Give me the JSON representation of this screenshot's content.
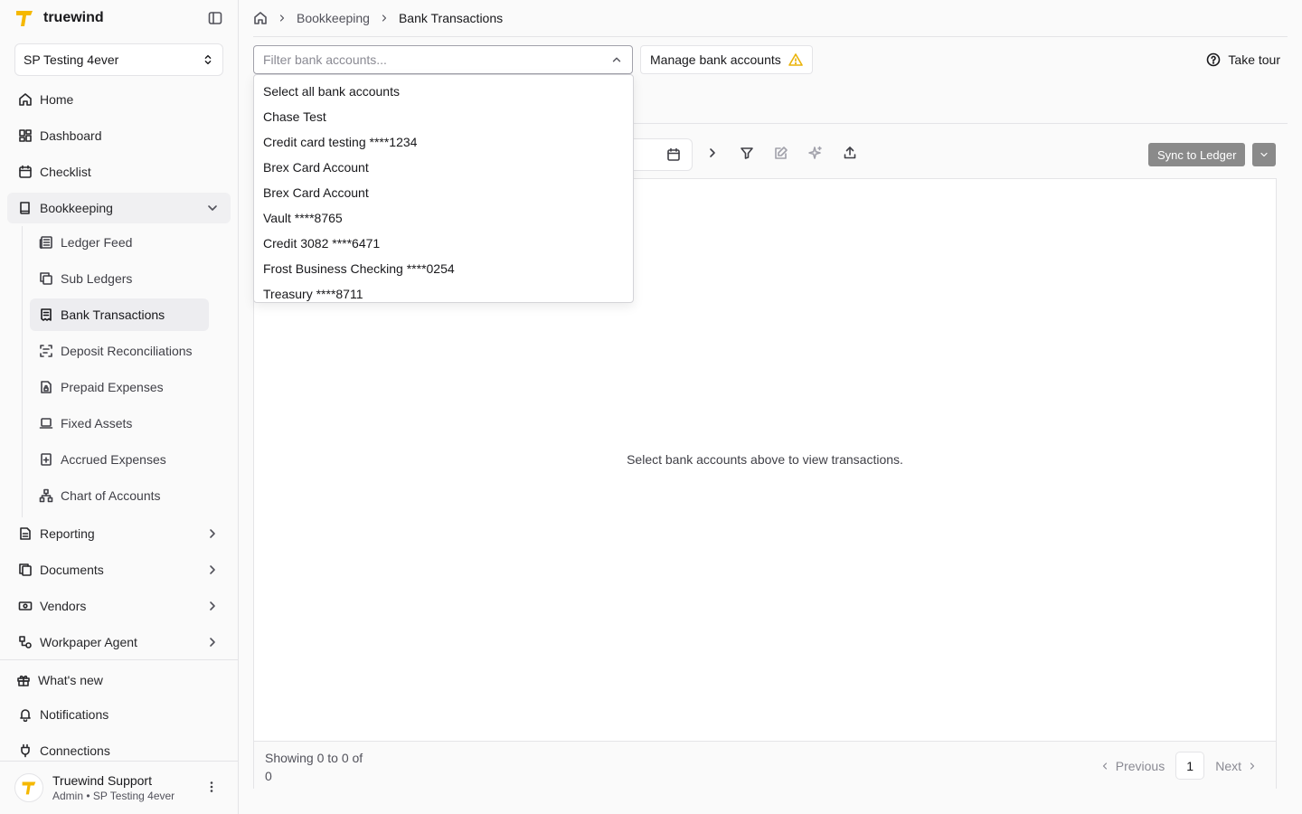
{
  "brand": {
    "name": "truewind",
    "accent": "#f5b800"
  },
  "org_selector": {
    "value": "SP Testing 4ever"
  },
  "nav": {
    "home": "Home",
    "dashboard": "Dashboard",
    "checklist": "Checklist",
    "bookkeeping": "Bookkeeping",
    "bookkeeping_items": [
      "Ledger Feed",
      "Sub Ledgers",
      "Bank Transactions",
      "Deposit Reconciliations",
      "Prepaid Expenses",
      "Fixed Assets",
      "Accrued Expenses",
      "Chart of Accounts"
    ],
    "reporting": "Reporting",
    "documents": "Documents",
    "vendors": "Vendors",
    "workpaper_agent": "Workpaper Agent",
    "whats_new": "What's new",
    "notifications": "Notifications",
    "connections": "Connections"
  },
  "user": {
    "name": "Truewind Support",
    "role": "Admin • SP Testing 4ever"
  },
  "breadcrumb": {
    "parent": "Bookkeeping",
    "current": "Bank Transactions"
  },
  "filter": {
    "placeholder": "Filter bank accounts..."
  },
  "manage_button": "Manage bank accounts",
  "tour_button": "Take tour",
  "sync_button": "Sync to Ledger",
  "dropdown_options": [
    "Select all bank accounts",
    "Chase Test",
    "Credit card testing ****1234",
    "Brex Card Account",
    "Brex Card Account",
    "Vault ****8765",
    "Credit 3082 ****6471",
    "Frost Business Checking ****0254",
    "Treasury ****8711"
  ],
  "empty_message": "Select bank accounts above to view transactions.",
  "footer": {
    "showing": "Showing 0 to 0 of 0",
    "previous": "Previous",
    "page": "1",
    "next": "Next"
  }
}
